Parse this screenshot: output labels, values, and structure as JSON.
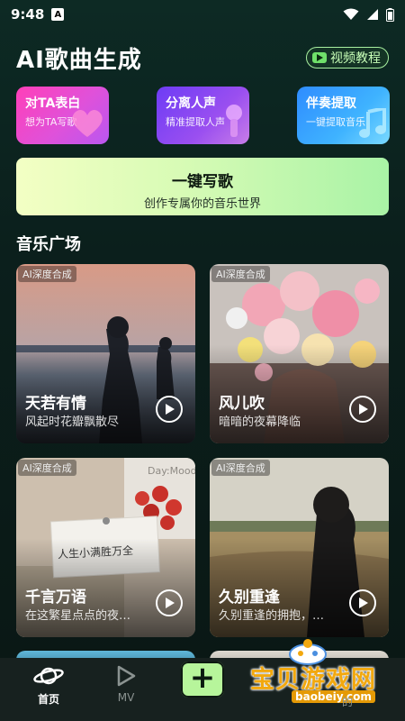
{
  "status_bar": {
    "time": "9:48",
    "app_badge": "A"
  },
  "header": {
    "title": "AI歌曲生成",
    "tutorial_label": "视频教程"
  },
  "features": [
    {
      "title": "对TA表白",
      "subtitle": "想为TA写歌"
    },
    {
      "title": "分离人声",
      "subtitle": "精准提取人声"
    },
    {
      "title": "伴奏提取",
      "subtitle": "一键提取音乐"
    }
  ],
  "write_song": {
    "title": "一键写歌",
    "subtitle": "创作专属你的音乐世界"
  },
  "section": {
    "title": "音乐广场"
  },
  "songs": [
    {
      "badge": "AI深度合成",
      "title": "天若有情",
      "subtitle": "风起时花瓣飘散尽"
    },
    {
      "badge": "AI深度合成",
      "title": "风儿吹",
      "subtitle": "暗暗的夜幕降临"
    },
    {
      "badge": "AI深度合成",
      "title": "千言万语",
      "subtitle": "在这繁星点点的夜…",
      "photo_text": "人生小满胜万全",
      "photo_stamp": "Day:Mood"
    },
    {
      "badge": "AI深度合成",
      "title": "久别重逢",
      "subtitle": "久别重逢的拥抱，…"
    }
  ],
  "bottom_nav": {
    "home": "首页",
    "mv": "MV",
    "create": "+"
  },
  "watermark": {
    "text": "宝贝游戏网",
    "url": "baobeiy.com",
    "faint": "的"
  },
  "colors": {
    "accent": "#b7f59b",
    "background": "#0b1d1a"
  }
}
